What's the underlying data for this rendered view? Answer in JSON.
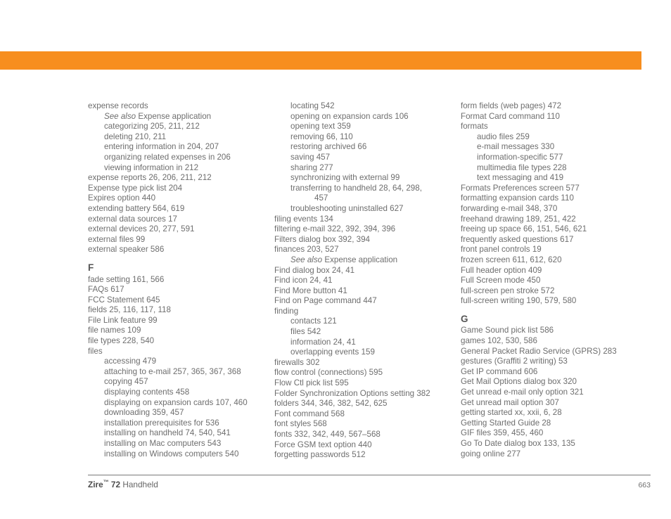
{
  "page": {
    "accent_color": "#f78e1e",
    "text_color": "#6e6e6e",
    "heading_color": "#555555"
  },
  "footer": {
    "brand": "Zire",
    "trademark": "™",
    "model": " 72",
    "product": " Handheld",
    "page_number": "663"
  },
  "columns": [
    {
      "id": "column-1",
      "blocks": [
        {
          "type": "entries",
          "items": [
            {
              "level": 0,
              "text": "expense records"
            },
            {
              "level": 1,
              "italic_prefix": "See also",
              "text": " Expense application"
            },
            {
              "level": 1,
              "text": "categorizing 205, 211, 212"
            },
            {
              "level": 1,
              "text": "deleting 210, 211"
            },
            {
              "level": 1,
              "text": "entering information in 204, 207"
            },
            {
              "level": 1,
              "text": "organizing related expenses in 206"
            },
            {
              "level": 1,
              "text": "viewing information in 212"
            },
            {
              "level": 0,
              "text": "expense reports 26, 206, 211, 212"
            },
            {
              "level": 0,
              "text": "Expense type pick list 204"
            },
            {
              "level": 0,
              "text": "Expires option 440"
            },
            {
              "level": 0,
              "text": "extending battery 564, 619"
            },
            {
              "level": 0,
              "text": "external data sources 17"
            },
            {
              "level": 0,
              "text": "external devices 20, 277, 591"
            },
            {
              "level": 0,
              "text": "external files 99"
            },
            {
              "level": 0,
              "text": "external speaker 586"
            }
          ]
        },
        {
          "type": "letter",
          "letter": "F"
        },
        {
          "type": "entries",
          "items": [
            {
              "level": 0,
              "text": "fade setting 161, 566"
            },
            {
              "level": 0,
              "text": "FAQs 617"
            },
            {
              "level": 0,
              "text": "FCC Statement 645"
            },
            {
              "level": 0,
              "text": "fields 25, 116, 117, 118"
            },
            {
              "level": 0,
              "text": "File Link feature 99"
            },
            {
              "level": 0,
              "text": "file names 109"
            },
            {
              "level": 0,
              "text": "file types 228, 540"
            },
            {
              "level": 0,
              "text": "files"
            },
            {
              "level": 1,
              "text": "accessing 479"
            },
            {
              "level": 1,
              "text": "attaching to e-mail 257, 365, 367, 368"
            },
            {
              "level": 1,
              "text": "copying 457"
            },
            {
              "level": 1,
              "text": "displaying contents 458"
            },
            {
              "level": 1,
              "text": "displaying on expansion cards 107, 460"
            },
            {
              "level": 1,
              "text": "downloading 359, 457"
            },
            {
              "level": 1,
              "text": "installation prerequisites for 536"
            },
            {
              "level": 1,
              "text": "installing on handheld 74, 540, 541"
            },
            {
              "level": 1,
              "text": "installing on Mac computers 543"
            },
            {
              "level": 1,
              "text": "installing on Windows computers 540"
            }
          ]
        }
      ]
    },
    {
      "id": "column-2",
      "blocks": [
        {
          "type": "entries",
          "items": [
            {
              "level": 1,
              "text": "locating 542"
            },
            {
              "level": 1,
              "text": "opening on expansion cards 106"
            },
            {
              "level": 1,
              "text": "opening text 359"
            },
            {
              "level": 1,
              "text": "removing 66, 110"
            },
            {
              "level": 1,
              "text": "restoring archived 66"
            },
            {
              "level": 1,
              "text": "saving 457"
            },
            {
              "level": 1,
              "text": "sharing 277"
            },
            {
              "level": 1,
              "text": "synchronizing with external 99"
            },
            {
              "level": 1,
              "text": "transferring to handheld 28, 64, 298,",
              "continuation": "457"
            },
            {
              "level": 1,
              "text": "troubleshooting uninstalled 627"
            },
            {
              "level": 0,
              "text": "filing events 134"
            },
            {
              "level": 0,
              "text": "filtering e-mail 322, 392, 394, 396"
            },
            {
              "level": 0,
              "text": "Filters dialog box 392, 394"
            },
            {
              "level": 0,
              "text": "finances 203, 527"
            },
            {
              "level": 1,
              "italic_prefix": "See also",
              "text": " Expense application"
            },
            {
              "level": 0,
              "text": "Find dialog box 24, 41"
            },
            {
              "level": 0,
              "text": "Find icon 24, 41"
            },
            {
              "level": 0,
              "text": "Find More button 41"
            },
            {
              "level": 0,
              "text": "Find on Page command 447"
            },
            {
              "level": 0,
              "text": "finding"
            },
            {
              "level": 1,
              "text": "contacts 121"
            },
            {
              "level": 1,
              "text": "files 542"
            },
            {
              "level": 1,
              "text": "information 24, 41"
            },
            {
              "level": 1,
              "text": "overlapping events 159"
            },
            {
              "level": 0,
              "text": "firewalls 302"
            },
            {
              "level": 0,
              "text": "flow control (connections) 595"
            },
            {
              "level": 0,
              "text": "Flow Ctl pick list 595"
            },
            {
              "level": 0,
              "text": "Folder Synchronization Options setting 382"
            },
            {
              "level": 0,
              "text": "folders 344, 346, 382, 542, 625"
            },
            {
              "level": 0,
              "text": "Font command 568"
            },
            {
              "level": 0,
              "text": "font styles 568"
            },
            {
              "level": 0,
              "text": "fonts 332, 342, 449, 567–568"
            },
            {
              "level": 0,
              "text": "Force GSM text option 440"
            },
            {
              "level": 0,
              "text": "forgetting passwords 512"
            }
          ]
        }
      ]
    },
    {
      "id": "column-3",
      "blocks": [
        {
          "type": "entries",
          "items": [
            {
              "level": 0,
              "text": "form fields (web pages) 472"
            },
            {
              "level": 0,
              "text": "Format Card command 110"
            },
            {
              "level": 0,
              "text": "formats"
            },
            {
              "level": 1,
              "text": "audio files 259"
            },
            {
              "level": 1,
              "text": "e-mail messages 330"
            },
            {
              "level": 1,
              "text": "information-specific 577"
            },
            {
              "level": 1,
              "text": "multimedia file types 228"
            },
            {
              "level": 1,
              "text": "text messaging and 419"
            },
            {
              "level": 0,
              "text": "Formats Preferences screen 577"
            },
            {
              "level": 0,
              "text": "formatting expansion cards 110"
            },
            {
              "level": 0,
              "text": "forwarding e-mail 348, 370"
            },
            {
              "level": 0,
              "text": "freehand drawing 189, 251, 422"
            },
            {
              "level": 0,
              "text": "freeing up space 66, 151, 546, 621"
            },
            {
              "level": 0,
              "text": "frequently asked questions 617"
            },
            {
              "level": 0,
              "text": "front panel controls 19"
            },
            {
              "level": 0,
              "text": "frozen screen 611, 612, 620"
            },
            {
              "level": 0,
              "text": "Full header option 409"
            },
            {
              "level": 0,
              "text": "Full Screen mode 450"
            },
            {
              "level": 0,
              "text": "full-screen pen stroke 572"
            },
            {
              "level": 0,
              "text": "full-screen writing 190, 579, 580"
            }
          ]
        },
        {
          "type": "letter",
          "letter": "G"
        },
        {
          "type": "entries",
          "items": [
            {
              "level": 0,
              "text": "Game Sound pick list 586"
            },
            {
              "level": 0,
              "text": "games 102, 530, 586"
            },
            {
              "level": 0,
              "text": "General Packet Radio Service (GPRS) 283"
            },
            {
              "level": 0,
              "text": "gestures (Graffiti 2 writing) 53"
            },
            {
              "level": 0,
              "text": "Get IP command 606"
            },
            {
              "level": 0,
              "text": "Get Mail Options dialog box 320"
            },
            {
              "level": 0,
              "text": "Get unread e-mail only option 321"
            },
            {
              "level": 0,
              "text": "Get unread mail option 307"
            },
            {
              "level": 0,
              "text": "getting started xx, xxii, 6, 28"
            },
            {
              "level": 0,
              "text": "Getting Started Guide 28"
            },
            {
              "level": 0,
              "text": "GIF files 359, 455, 460"
            },
            {
              "level": 0,
              "text": "Go To Date dialog box 133, 135"
            },
            {
              "level": 0,
              "text": "going online 277"
            }
          ]
        }
      ]
    }
  ]
}
